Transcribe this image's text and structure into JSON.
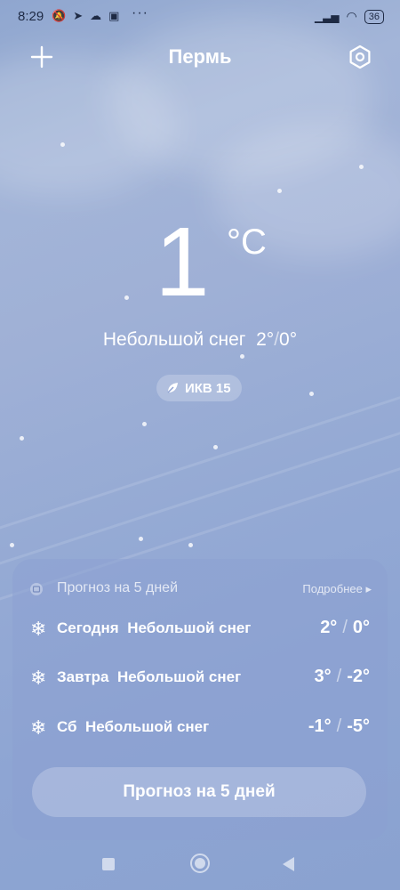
{
  "status": {
    "time": "8:29",
    "battery": "36",
    "more": "···"
  },
  "header": {
    "city": "Пермь"
  },
  "current": {
    "temperature": "1",
    "unit": "°C",
    "condition": "Небольшой снег",
    "high": "2°",
    "low": "0°",
    "aqi_label": "ИКВ 15"
  },
  "forecast": {
    "title": "Прогноз на 5 дней",
    "more_label": "Подробнее",
    "days": [
      {
        "day": "Сегодня",
        "condition": "Небольшой снег",
        "high": "2°",
        "low": "0°"
      },
      {
        "day": "Завтра",
        "condition": "Небольшой снег",
        "high": "3°",
        "low": "-2°"
      },
      {
        "day": "Сб",
        "condition": "Небольшой снег",
        "high": "-1°",
        "low": "-5°"
      }
    ],
    "button_label": "Прогноз на 5 дней"
  },
  "icons": {
    "add": "plus-icon",
    "settings": "hexagon-settings-icon",
    "aqi": "leaf-icon",
    "snow": "snowflake-icon"
  }
}
